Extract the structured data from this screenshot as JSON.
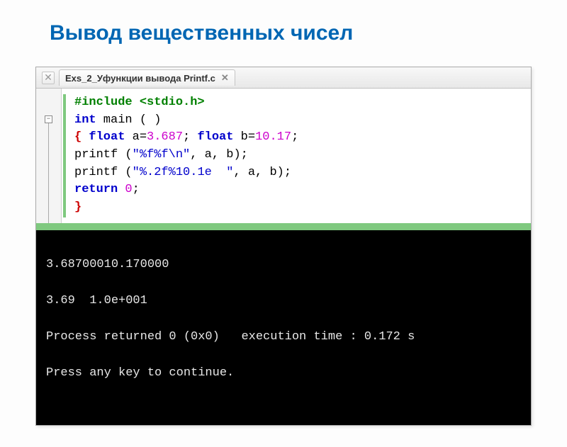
{
  "title": "Вывод вещественных чисел",
  "tab": {
    "label": "Exs_2_Уфункции вывода Printf.c",
    "close_glyph": "✕"
  },
  "code": {
    "l1_pre": "#include <stdio.h>",
    "l2_kw1": "int",
    "l2_rest": " main ( )",
    "l3_open": "{",
    "l3_kw1": " float",
    "l3_var1": " a=",
    "l3_num1": "3.687",
    "l3_sep1": ";",
    "l3_kw2": " float",
    "l3_var2": " b=",
    "l3_num2": "10.17",
    "l3_sep2": ";",
    "l4_fn": "printf (",
    "l4_str": "\"%f%f\\n\"",
    "l4_rest": ", a, b);",
    "l5_fn": "printf (",
    "l5_str": "\"%.2f%10.1e  \"",
    "l5_rest": ", a, b);",
    "l6_kw": "return",
    "l6_rest": " ",
    "l6_num": "0",
    "l6_sep": ";",
    "l7_close": "}"
  },
  "console": {
    "line1": "3.68700010.170000",
    "line2": "3.69  1.0e+001",
    "line3": "Process returned 0 (0x0)   execution time : 0.172 s",
    "line4": "Press any key to continue."
  },
  "fold_glyph": "−"
}
